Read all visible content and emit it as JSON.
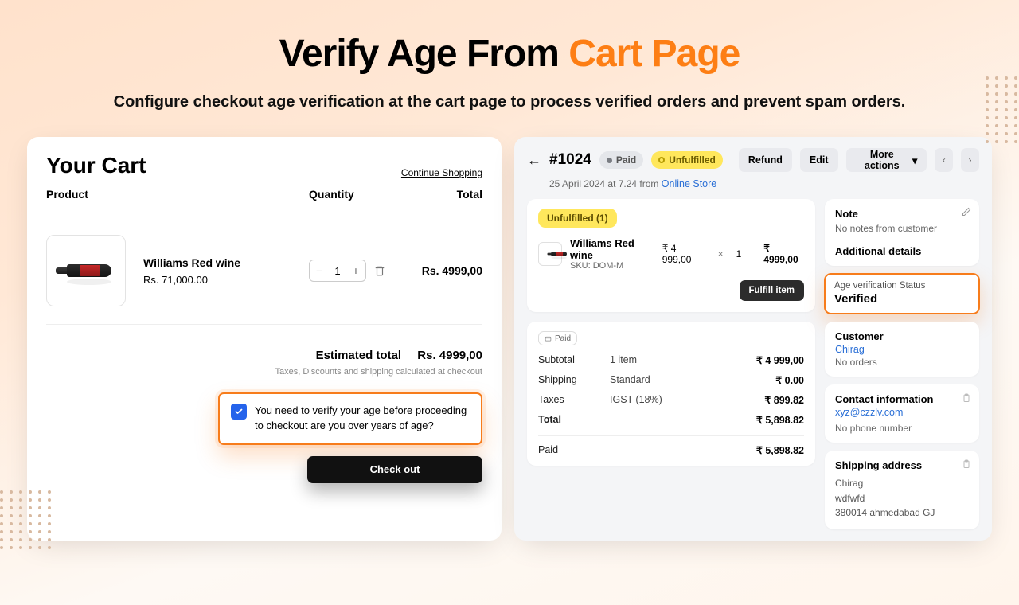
{
  "hero": {
    "title_a": "Verify Age From ",
    "title_b": "Cart Page",
    "subtitle": "Configure checkout age verification at the cart page to process verified orders and prevent spam orders."
  },
  "cart": {
    "heading": "Your Cart",
    "continue": "Continue Shopping",
    "col_product": "Product",
    "col_qty": "Quantity",
    "col_total": "Total",
    "item": {
      "name": "Williams Red wine",
      "price": "Rs. 71,000.00",
      "qty": "1",
      "line_total": "Rs. 4999,00"
    },
    "est_label": "Estimated total",
    "est_value": "Rs. 4999,00",
    "tax_note": "Taxes, Discounts and shipping calculated at checkout",
    "verify_text": "You need to verify your age before proceeding to checkout are you over years of age?",
    "checkout": "Check out"
  },
  "order": {
    "id": "#1024",
    "paid_pill": "Paid",
    "unfulfilled_pill": "Unfulfilled",
    "refund": "Refund",
    "edit": "Edit",
    "more": "More actions",
    "meta_a": "25 April 2024 at 7.24 from ",
    "meta_link": "Online Store",
    "unfulfilled_tag": "Unfulfilled (1)",
    "item": {
      "name": "Williams Red wine",
      "sku": "SKU: DOM-M",
      "price": "₹ 4 999,00",
      "x": "×",
      "qty": "1",
      "line_total": "₹ 4999,00"
    },
    "fulfill": "Fulfill item",
    "mini_paid": "Paid",
    "summary": {
      "subtotal_l": "Subtotal",
      "subtotal_m": "1 item",
      "subtotal_v": "₹ 4 999,00",
      "ship_l": "Shipping",
      "ship_m": "Standard",
      "ship_v": "₹ 0.00",
      "tax_l": "Taxes",
      "tax_m": "IGST (18%)",
      "tax_v": "₹ 899.82",
      "total_l": "Total",
      "total_v": "₹ 5,898.82",
      "paid_l": "Paid",
      "paid_v": "₹ 5,898.82"
    },
    "note": {
      "h": "Note",
      "t": "No notes from customer"
    },
    "add_h": "Additional details",
    "avs": {
      "l": "Age verification Status",
      "v": "Verified"
    },
    "cust": {
      "h": "Customer",
      "name": "Chirag",
      "sub": "No orders"
    },
    "contact": {
      "h": "Contact information",
      "email": "xyz@czzlv.com",
      "phone": "No phone number"
    },
    "ship": {
      "h": "Shipping address",
      "l1": "Chirag",
      "l2": "wdfwfd",
      "l3": "380014 ahmedabad GJ"
    }
  }
}
